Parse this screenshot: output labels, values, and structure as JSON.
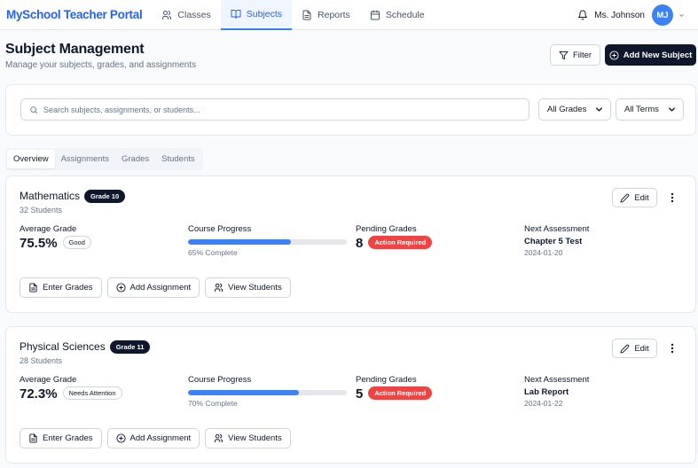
{
  "header": {
    "brand": "MySchool Teacher Portal",
    "nav": [
      {
        "label": "Classes",
        "icon": "users-icon"
      },
      {
        "label": "Subjects",
        "icon": "book-icon",
        "active": true
      },
      {
        "label": "Reports",
        "icon": "file-icon"
      },
      {
        "label": "Schedule",
        "icon": "calendar-icon"
      }
    ],
    "user_name": "Ms. Johnson",
    "avatar_initials": "MJ"
  },
  "page": {
    "title": "Subject Management",
    "subtitle": "Manage your subjects, grades, and assignments",
    "filter_label": "Filter",
    "add_label": "Add New Subject"
  },
  "search": {
    "placeholder": "Search subjects, assignments, or students...",
    "grades_select": "All Grades",
    "terms_select": "All Terms"
  },
  "tabs": [
    "Overview",
    "Assignments",
    "Grades",
    "Students"
  ],
  "labels": {
    "average_grade": "Average Grade",
    "course_progress": "Course Progress",
    "pending_grades": "Pending Grades",
    "next_assessment": "Next Assessment",
    "edit": "Edit",
    "enter_grades": "Enter Grades",
    "add_assignment": "Add Assignment",
    "view_students": "View Students"
  },
  "subjects": [
    {
      "name": "Mathematics",
      "grade": "Grade 10",
      "students": "32 Students",
      "average": "75.5%",
      "average_status": "Good",
      "progress_pct": 65,
      "progress_text": "65% Complete",
      "pending": "8",
      "pending_status": "Action Required",
      "assessment": "Chapter 5 Test",
      "assessment_date": "2024-01-20"
    },
    {
      "name": "Physical Sciences",
      "grade": "Grade 11",
      "students": "28 Students",
      "average": "72.3%",
      "average_status": "Needs Attention",
      "progress_pct": 70,
      "progress_text": "70% Complete",
      "pending": "5",
      "pending_status": "Action Required",
      "assessment": "Lab Report",
      "assessment_date": "2024-01-22"
    }
  ],
  "colors": {
    "brand": "#2563eb",
    "accent": "#3b82f6",
    "dark": "#0f172a",
    "danger": "#ef4444"
  }
}
